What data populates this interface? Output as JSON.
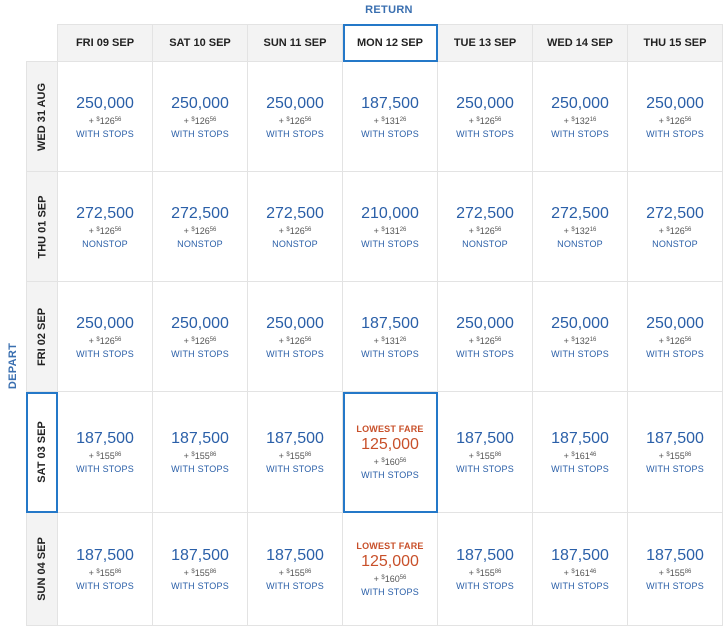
{
  "labels": {
    "return": "RETURN",
    "depart": "DEPART",
    "lowest_fare": "LOWEST FARE"
  },
  "columns": [
    "FRI 09 SEP",
    "SAT 10 SEP",
    "SUN 11 SEP",
    "MON 12 SEP",
    "TUE 13 SEP",
    "WED 14 SEP",
    "THU 15 SEP"
  ],
  "selected_column": 3,
  "selected_row": 3,
  "rows": [
    {
      "label": "WED 31 AUG",
      "cells": [
        {
          "miles": "250,000",
          "tax_dollars": "126",
          "tax_cents": "56",
          "stops": "WITH STOPS"
        },
        {
          "miles": "250,000",
          "tax_dollars": "126",
          "tax_cents": "56",
          "stops": "WITH STOPS"
        },
        {
          "miles": "250,000",
          "tax_dollars": "126",
          "tax_cents": "56",
          "stops": "WITH STOPS"
        },
        {
          "miles": "187,500",
          "tax_dollars": "131",
          "tax_cents": "26",
          "stops": "WITH STOPS"
        },
        {
          "miles": "250,000",
          "tax_dollars": "126",
          "tax_cents": "56",
          "stops": "WITH STOPS"
        },
        {
          "miles": "250,000",
          "tax_dollars": "132",
          "tax_cents": "16",
          "stops": "WITH STOPS"
        },
        {
          "miles": "250,000",
          "tax_dollars": "126",
          "tax_cents": "56",
          "stops": "WITH STOPS"
        }
      ]
    },
    {
      "label": "THU 01 SEP",
      "cells": [
        {
          "miles": "272,500",
          "tax_dollars": "126",
          "tax_cents": "56",
          "stops": "NONSTOP"
        },
        {
          "miles": "272,500",
          "tax_dollars": "126",
          "tax_cents": "56",
          "stops": "NONSTOP"
        },
        {
          "miles": "272,500",
          "tax_dollars": "126",
          "tax_cents": "56",
          "stops": "NONSTOP"
        },
        {
          "miles": "210,000",
          "tax_dollars": "131",
          "tax_cents": "26",
          "stops": "WITH STOPS"
        },
        {
          "miles": "272,500",
          "tax_dollars": "126",
          "tax_cents": "56",
          "stops": "NONSTOP"
        },
        {
          "miles": "272,500",
          "tax_dollars": "132",
          "tax_cents": "16",
          "stops": "NONSTOP"
        },
        {
          "miles": "272,500",
          "tax_dollars": "126",
          "tax_cents": "56",
          "stops": "NONSTOP"
        }
      ]
    },
    {
      "label": "FRI 02 SEP",
      "cells": [
        {
          "miles": "250,000",
          "tax_dollars": "126",
          "tax_cents": "56",
          "stops": "WITH STOPS"
        },
        {
          "miles": "250,000",
          "tax_dollars": "126",
          "tax_cents": "56",
          "stops": "WITH STOPS"
        },
        {
          "miles": "250,000",
          "tax_dollars": "126",
          "tax_cents": "56",
          "stops": "WITH STOPS"
        },
        {
          "miles": "187,500",
          "tax_dollars": "131",
          "tax_cents": "26",
          "stops": "WITH STOPS"
        },
        {
          "miles": "250,000",
          "tax_dollars": "126",
          "tax_cents": "56",
          "stops": "WITH STOPS"
        },
        {
          "miles": "250,000",
          "tax_dollars": "132",
          "tax_cents": "16",
          "stops": "WITH STOPS"
        },
        {
          "miles": "250,000",
          "tax_dollars": "126",
          "tax_cents": "56",
          "stops": "WITH STOPS"
        }
      ]
    },
    {
      "label": "SAT 03 SEP",
      "cells": [
        {
          "miles": "187,500",
          "tax_dollars": "155",
          "tax_cents": "86",
          "stops": "WITH STOPS"
        },
        {
          "miles": "187,500",
          "tax_dollars": "155",
          "tax_cents": "86",
          "stops": "WITH STOPS"
        },
        {
          "miles": "187,500",
          "tax_dollars": "155",
          "tax_cents": "86",
          "stops": "WITH STOPS"
        },
        {
          "miles": "125,000",
          "tax_dollars": "160",
          "tax_cents": "56",
          "stops": "WITH STOPS",
          "lowest": true
        },
        {
          "miles": "187,500",
          "tax_dollars": "155",
          "tax_cents": "86",
          "stops": "WITH STOPS"
        },
        {
          "miles": "187,500",
          "tax_dollars": "161",
          "tax_cents": "46",
          "stops": "WITH STOPS"
        },
        {
          "miles": "187,500",
          "tax_dollars": "155",
          "tax_cents": "86",
          "stops": "WITH STOPS"
        }
      ]
    },
    {
      "label": "SUN 04 SEP",
      "cells": [
        {
          "miles": "187,500",
          "tax_dollars": "155",
          "tax_cents": "86",
          "stops": "WITH STOPS"
        },
        {
          "miles": "187,500",
          "tax_dollars": "155",
          "tax_cents": "86",
          "stops": "WITH STOPS"
        },
        {
          "miles": "187,500",
          "tax_dollars": "155",
          "tax_cents": "86",
          "stops": "WITH STOPS"
        },
        {
          "miles": "125,000",
          "tax_dollars": "160",
          "tax_cents": "56",
          "stops": "WITH STOPS",
          "lowest": true
        },
        {
          "miles": "187,500",
          "tax_dollars": "155",
          "tax_cents": "86",
          "stops": "WITH STOPS"
        },
        {
          "miles": "187,500",
          "tax_dollars": "161",
          "tax_cents": "46",
          "stops": "WITH STOPS"
        },
        {
          "miles": "187,500",
          "tax_dollars": "155",
          "tax_cents": "86",
          "stops": "WITH STOPS"
        }
      ]
    }
  ],
  "colors": {
    "accent_blue": "#2a5fa8",
    "selected_border": "#2478c8",
    "lowest_orange": "#c8502a"
  }
}
